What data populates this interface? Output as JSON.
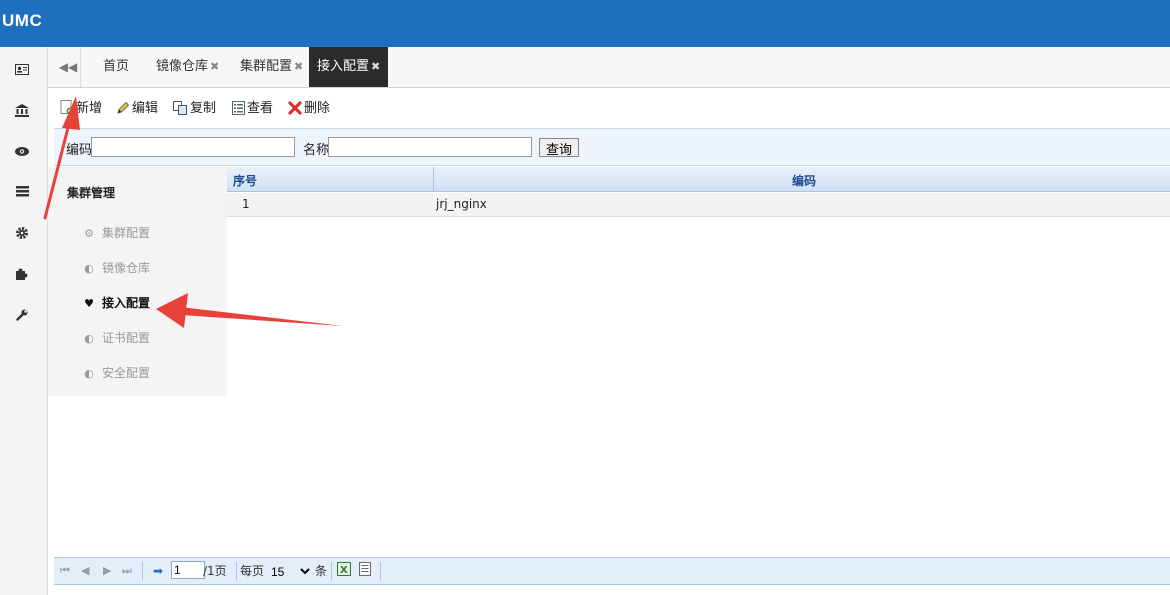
{
  "app": {
    "title": "UMC"
  },
  "sidebar": {
    "icons": [
      "id-card-icon",
      "bank-icon",
      "eye-icon",
      "list-icon",
      "gear-icon",
      "puzzle-icon",
      "wrench-icon"
    ]
  },
  "tabs": [
    {
      "label": "首页",
      "closable": false
    },
    {
      "label": "镜像仓库",
      "closable": true
    },
    {
      "label": "集群配置",
      "closable": true
    },
    {
      "label": "接入配置",
      "closable": true,
      "active": true
    }
  ],
  "toolbar": {
    "add": "新增",
    "edit": "编辑",
    "copy": "复制",
    "view": "查看",
    "delete": "删除"
  },
  "search": {
    "code_label": "编码",
    "name_label": "名称",
    "code_value": "",
    "name_value": "",
    "query_button": "查询"
  },
  "grid": {
    "columns": [
      "序号",
      "编码"
    ],
    "rows": [
      {
        "index": "1",
        "code": "jrj_nginx"
      }
    ]
  },
  "flyout": {
    "title": "集群管理",
    "items": [
      {
        "label": "集群配置",
        "icon": "cogs-icon",
        "active": false
      },
      {
        "label": "镜像仓库",
        "icon": "leaf-icon",
        "active": false
      },
      {
        "label": "接入配置",
        "icon": "heartbeat-icon",
        "active": true
      },
      {
        "label": "证书配置",
        "icon": "leaf-icon",
        "active": false
      },
      {
        "label": "安全配置",
        "icon": "leaf-icon",
        "active": false
      }
    ]
  },
  "pager": {
    "page_value": "1",
    "page_total": "/1页",
    "per_page_label": "每页",
    "per_page_value": "15",
    "per_page_unit": "条"
  },
  "colors": {
    "header": "#1f6fbf",
    "annotation_arrow": "#e8413a"
  }
}
